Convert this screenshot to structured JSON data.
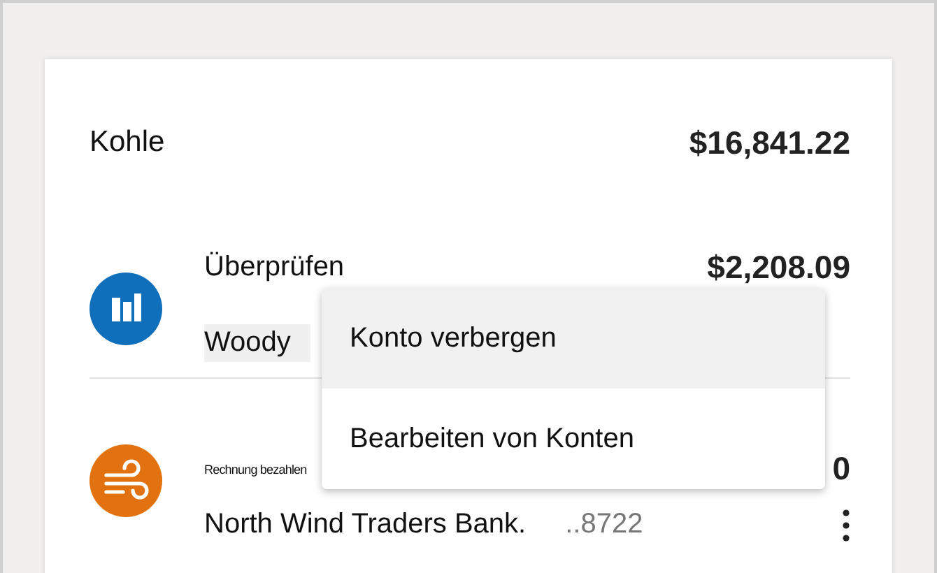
{
  "card": {
    "title": "Kohle",
    "total": "$16,841.22"
  },
  "accounts": [
    {
      "kind": "bars",
      "name": "Überprüfen",
      "amount": "$2,208.09",
      "owner": "Woody",
      "owner_highlighted": true
    },
    {
      "kind": "wind",
      "label": "Rechnung bezahlen",
      "amount": "0",
      "name": "North Wind Traders Bank.",
      "number": "..8722",
      "has_menu": true
    }
  ],
  "context_menu": [
    {
      "label": "Konto verbergen",
      "selected": true
    },
    {
      "label": "Bearbeiten von Konten",
      "selected": false
    }
  ]
}
